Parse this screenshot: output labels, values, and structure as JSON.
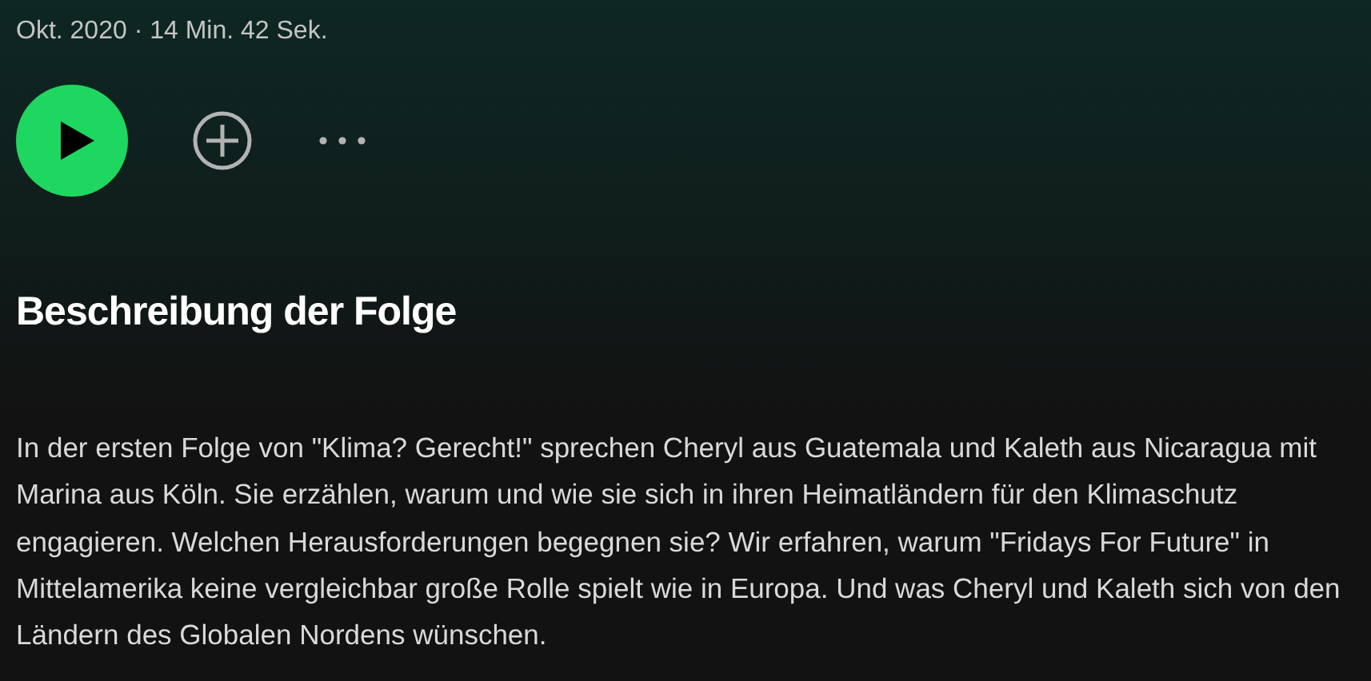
{
  "episode_meta": "Okt. 2020 · 14 Min. 42 Sek.",
  "controls": {
    "playing": false
  },
  "description_heading": "Beschreibung der Folge",
  "description": "In der ersten Folge von \"Klima? Gerecht!\" sprechen Cheryl aus Guatemala und Kaleth aus Nicaragua mit Marina aus Köln. Sie erzählen, warum und wie sie sich in ihren Heimatländern für den Klimaschutz engagieren. Welchen Herausforderungen begegnen sie? Wir erfahren, warum \"Fridays For Future\" in Mittelamerika keine vergleichbar große Rolle spielt wie in Europa. Und was Cheryl und Kaleth sich von den Ländern des Globalen Nordens wünschen."
}
